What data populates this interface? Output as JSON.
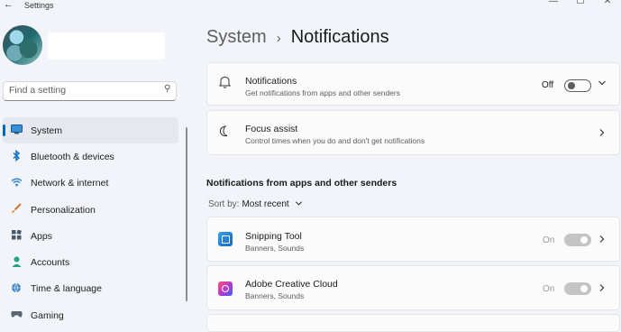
{
  "window": {
    "title": "Settings",
    "back_glyph": "←",
    "min_glyph": "—",
    "max_glyph": "☐",
    "close_glyph": "✕"
  },
  "sidebar": {
    "search": {
      "placeholder": "Find a setting"
    },
    "items": [
      {
        "label": "System",
        "icon": "monitor-icon",
        "active": true
      },
      {
        "label": "Bluetooth & devices",
        "icon": "bluetooth-icon"
      },
      {
        "label": "Network & internet",
        "icon": "wifi-icon"
      },
      {
        "label": "Personalization",
        "icon": "brush-icon"
      },
      {
        "label": "Apps",
        "icon": "apps-icon"
      },
      {
        "label": "Accounts",
        "icon": "person-icon"
      },
      {
        "label": "Time & language",
        "icon": "globe-clock-icon"
      },
      {
        "label": "Gaming",
        "icon": "gamepad-icon"
      }
    ]
  },
  "breadcrumb": {
    "parent": "System",
    "separator": "›",
    "current": "Notifications"
  },
  "cards": {
    "notifications": {
      "title": "Notifications",
      "desc": "Get notifications from apps and other senders",
      "state": "Off",
      "icon": "bell-icon"
    },
    "focus_assist": {
      "title": "Focus assist",
      "desc": "Control times when you do and don't get notifications",
      "icon": "moon-icon"
    }
  },
  "apps_section": {
    "heading": "Notifications from apps and other senders",
    "sort_label": "Sort by:",
    "sort_value": "Most recent",
    "apps": [
      {
        "name": "Snipping Tool",
        "desc": "Banners, Sounds",
        "state": "On",
        "icon": "snipping-tool-icon"
      },
      {
        "name": "Adobe Creative Cloud",
        "desc": "Banners, Sounds",
        "state": "On",
        "icon": "adobe-creative-cloud-icon"
      }
    ]
  },
  "colors": {
    "accent": "#0067c0",
    "background": "#f2f4f9",
    "card": "#fbfbfb"
  }
}
